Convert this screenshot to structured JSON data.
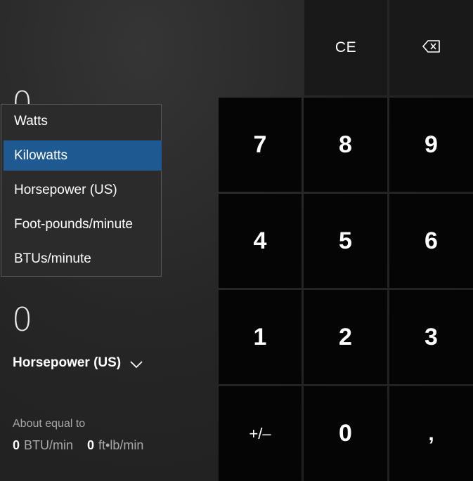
{
  "input": {
    "value": "0"
  },
  "output": {
    "value": "0",
    "unit": "Horsepower (US)"
  },
  "equivalents": {
    "label": "About equal to",
    "items": [
      {
        "value": "0",
        "unit": "BTU/min"
      },
      {
        "value": "0",
        "unit": "ft•lb/min"
      }
    ]
  },
  "dropdown": {
    "options": [
      "Watts",
      "Kilowatts",
      "Horsepower (US)",
      "Foot-pounds/minute",
      "BTUs/minute"
    ],
    "selected": "Kilowatts"
  },
  "keypad": {
    "ce": "CE",
    "backspace_icon": "backspace-icon",
    "digits": [
      "7",
      "8",
      "9",
      "4",
      "5",
      "6",
      "1",
      "2",
      "3"
    ],
    "plusminus": "+/–",
    "zero": "0",
    "decimal": ","
  },
  "colors": {
    "selected_highlight": "#1e5a91",
    "digit_key_bg": "#050505",
    "function_key_bg": "#191919"
  }
}
